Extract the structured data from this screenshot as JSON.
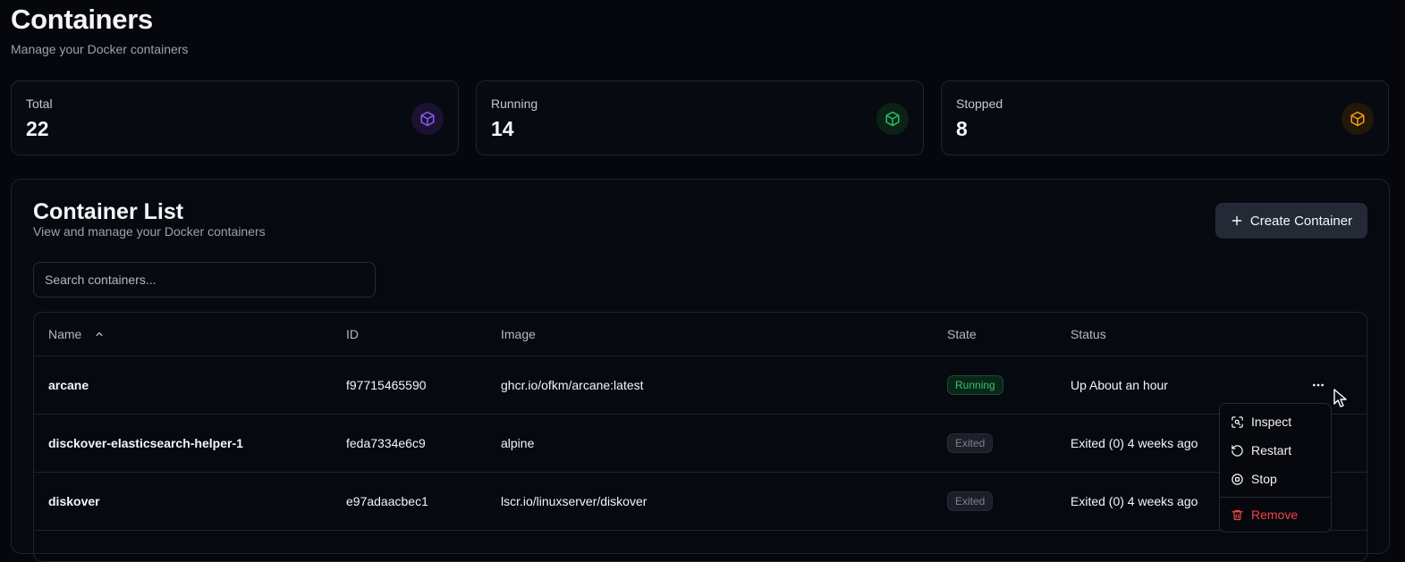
{
  "page": {
    "title": "Containers",
    "subtitle": "Manage your Docker containers"
  },
  "stats": [
    {
      "label": "Total",
      "value": "22",
      "icon": "box-icon",
      "color": "#8b5cf6"
    },
    {
      "label": "Running",
      "value": "14",
      "icon": "box-icon",
      "color": "#22c55e"
    },
    {
      "label": "Stopped",
      "value": "8",
      "icon": "box-icon",
      "color": "#f59e0b"
    }
  ],
  "list": {
    "title": "Container List",
    "subtitle": "View and manage your Docker containers",
    "create_label": "Create Container",
    "search_placeholder": "Search containers...",
    "columns": {
      "name": "Name",
      "id": "ID",
      "image": "Image",
      "state": "State",
      "status": "Status"
    },
    "rows": [
      {
        "name": "arcane",
        "id": "f97715465590",
        "image": "ghcr.io/ofkm/arcane:latest",
        "state": "Running",
        "status": "Up About an hour"
      },
      {
        "name": "disckover-elasticsearch-helper-1",
        "id": "feda7334e6c9",
        "image": "alpine",
        "state": "Exited",
        "status": "Exited (0) 4 weeks ago"
      },
      {
        "name": "diskover",
        "id": "e97adaacbec1",
        "image": "lscr.io/linuxserver/diskover",
        "state": "Exited",
        "status": "Exited (0) 4 weeks ago"
      }
    ]
  },
  "context_menu": {
    "items": [
      {
        "label": "Inspect",
        "icon": "inspect-icon"
      },
      {
        "label": "Restart",
        "icon": "restart-icon"
      },
      {
        "label": "Stop",
        "icon": "stop-icon"
      },
      {
        "label": "Remove",
        "icon": "trash-icon",
        "color": "#ef4444"
      }
    ]
  },
  "colors": {
    "background": "#05070d",
    "border": "#1d2330",
    "running": "#2fc66b",
    "exited": "#7c828d",
    "danger": "#ef4444"
  }
}
